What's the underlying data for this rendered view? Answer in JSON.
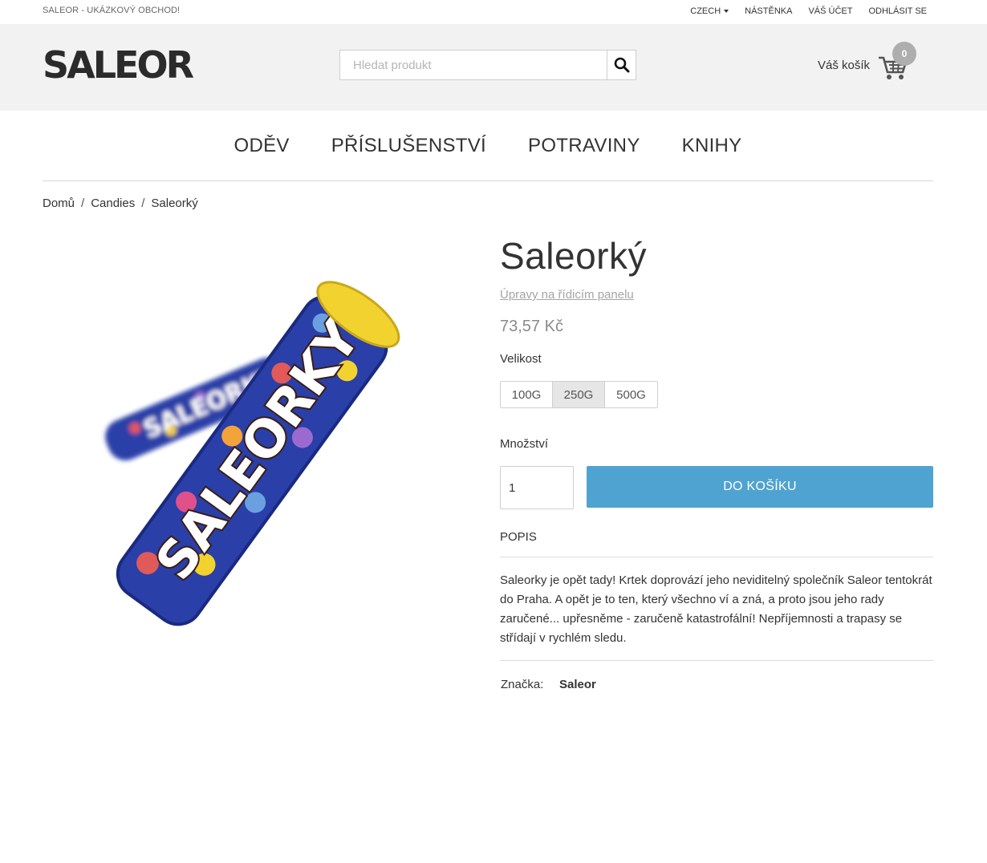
{
  "topbar": {
    "tagline": "SALEOR - UKÁZKOVÝ OBCHOD!",
    "language": "CZECH",
    "dashboard": "NÁSTĚNKA",
    "account": "VÁŠ ÚČET",
    "logout": "ODHLÁSIT SE"
  },
  "header": {
    "logo": "SALEOR",
    "search_placeholder": "Hledat produkt",
    "cart_label": "Váš košík",
    "cart_count": "0"
  },
  "nav": {
    "items": [
      "ODĚV",
      "PŘÍSLUŠENSTVÍ",
      "POTRAVINY",
      "KNIHY"
    ]
  },
  "breadcrumb": [
    "Domů",
    "Candies",
    "Saleorký"
  ],
  "product": {
    "image_text": "SALEORKY",
    "title": "Saleorký",
    "dashboard_link": "Úpravy na řídicím panelu",
    "price": "73,57 Kč",
    "size_label": "Velikost",
    "sizes": [
      "100G",
      "250G",
      "500G"
    ],
    "selected_size": "250G",
    "quantity_label": "Množství",
    "quantity": "1",
    "add_button": "DO KOŠÍKU",
    "description_heading": "POPIS",
    "description": "Saleorky je opět tady! Krtek doprovází jeho neviditelný společník Saleor tentokrát do Praha. A opět je to ten, který všechno ví a zná, a proto jsou jeho rady zaručené... upřesněme - zaručeně katastrofální! Nepříjemnosti a trapasy se střídají v rychlém sledu.",
    "brand_label": "Značka:",
    "brand": "Saleor"
  },
  "colors": {
    "accent": "#4fa3d0",
    "header_bg": "#f2f2f2",
    "tube_blue": "#2a3fa8",
    "cap_yellow": "#f2d22e"
  }
}
